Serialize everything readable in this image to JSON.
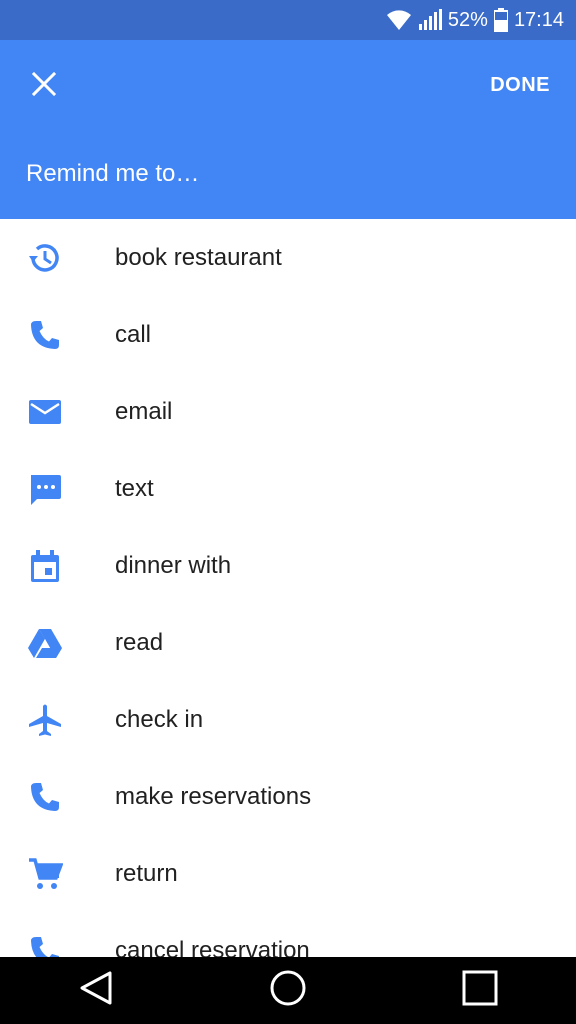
{
  "status_bar": {
    "battery_percent": "52%",
    "time": "17:14",
    "icons": [
      "wifi-icon",
      "signal-icon",
      "battery-icon"
    ]
  },
  "app_bar": {
    "close_icon": "close-icon",
    "done_label": "DONE",
    "prompt": "Remind me to…"
  },
  "colors": {
    "accent": "#4285F4",
    "status_bar": "#3A6BC9",
    "text": "#212121"
  },
  "list": {
    "items": [
      {
        "label": "book restaurant",
        "icon": "restore-clock-icon"
      },
      {
        "label": "call",
        "icon": "phone-icon"
      },
      {
        "label": "email",
        "icon": "email-icon"
      },
      {
        "label": "text",
        "icon": "message-icon"
      },
      {
        "label": "dinner with",
        "icon": "calendar-icon"
      },
      {
        "label": "read",
        "icon": "drive-icon"
      },
      {
        "label": "check in",
        "icon": "airplane-icon"
      },
      {
        "label": "make reservations",
        "icon": "phone-icon"
      },
      {
        "label": "return",
        "icon": "cart-icon"
      },
      {
        "label": "cancel reservation",
        "icon": "phone-icon"
      }
    ]
  },
  "nav_bar": {
    "buttons": [
      "back-icon",
      "home-icon",
      "recents-icon"
    ]
  }
}
